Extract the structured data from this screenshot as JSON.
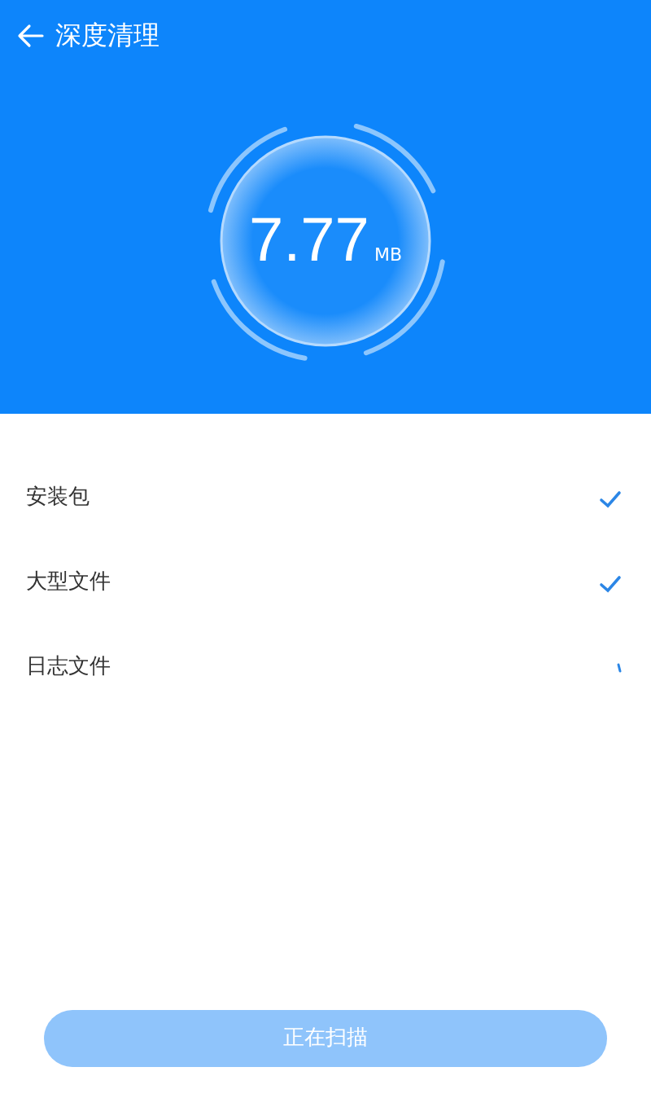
{
  "header": {
    "title": "深度清理"
  },
  "gauge": {
    "value": "7.77",
    "unit": "MB"
  },
  "items": [
    {
      "label": "安装包",
      "kind": "done"
    },
    {
      "label": "大型文件",
      "kind": "done"
    },
    {
      "label": "日志文件",
      "kind": "pending"
    }
  ],
  "button": {
    "label": "正在扫描",
    "disabled": true
  }
}
